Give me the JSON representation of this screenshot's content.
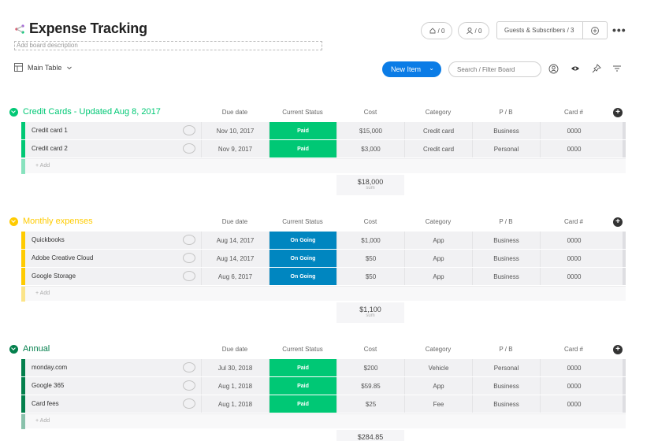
{
  "board": {
    "title": "Expense Tracking",
    "description_placeholder": "Add board description",
    "activity_count": "/ 0",
    "members_count": "/ 0",
    "guests_label": "Guests & Subscribers / 3",
    "more_icon": "•••",
    "view_name": "Main Table",
    "new_item_label": "New Item",
    "search_placeholder": "Search / Filter Board"
  },
  "columns": {
    "due": "Due date",
    "status": "Current Status",
    "cost": "Cost",
    "category": "Category",
    "pb": "P / B",
    "card": "Card #"
  },
  "groups": [
    {
      "title": "Credit Cards - Updated Aug 8, 2017",
      "color": "#00c875",
      "sum": "$18,000",
      "sum_label": "sum",
      "add_label": "+ Add",
      "rows": [
        {
          "name": "Credit card 1",
          "due": "Nov 10, 2017",
          "status": "Paid",
          "status_color": "#00c875",
          "cost": "$15,000",
          "category": "Credit card",
          "pb": "Business",
          "card": "0000"
        },
        {
          "name": "Credit card 2",
          "due": "Nov 9, 2017",
          "status": "Paid",
          "status_color": "#00c875",
          "cost": "$3,000",
          "category": "Credit card",
          "pb": "Personal",
          "card": "0000"
        }
      ]
    },
    {
      "title": "Monthly expenses",
      "color": "#ffcb00",
      "sum": "$1,100",
      "sum_label": "sum",
      "add_label": "+ Add",
      "rows": [
        {
          "name": "Quickbooks",
          "due": "Aug 14, 2017",
          "status": "On Going",
          "status_color": "#0086c0",
          "cost": "$1,000",
          "category": "App",
          "pb": "Business",
          "card": "0000"
        },
        {
          "name": "Adobe Creative Cloud",
          "due": "Aug 14, 2017",
          "status": "On Going",
          "status_color": "#0086c0",
          "cost": "$50",
          "category": "App",
          "pb": "Business",
          "card": "0000"
        },
        {
          "name": "Google Storage",
          "due": "Aug 6, 2017",
          "status": "On Going",
          "status_color": "#0086c0",
          "cost": "$50",
          "category": "App",
          "pb": "Business",
          "card": "0000"
        }
      ]
    },
    {
      "title": "Annual",
      "color": "#037f4c",
      "sum": "$284.85",
      "sum_label": "sum",
      "add_label": "+ Add",
      "rows": [
        {
          "name": "monday.com",
          "due": "Jul 30, 2018",
          "status": "Paid",
          "status_color": "#00c875",
          "cost": "$200",
          "category": "Vehicle",
          "pb": "Personal",
          "card": "0000"
        },
        {
          "name": "Google 365",
          "due": "Aug 1, 2018",
          "status": "Paid",
          "status_color": "#00c875",
          "cost": "$59.85",
          "category": "App",
          "pb": "Business",
          "card": "0000"
        },
        {
          "name": "Card fees",
          "due": "Aug 1, 2018",
          "status": "Paid",
          "status_color": "#00c875",
          "cost": "$25",
          "category": "Fee",
          "pb": "Business",
          "card": "0000"
        }
      ]
    }
  ]
}
